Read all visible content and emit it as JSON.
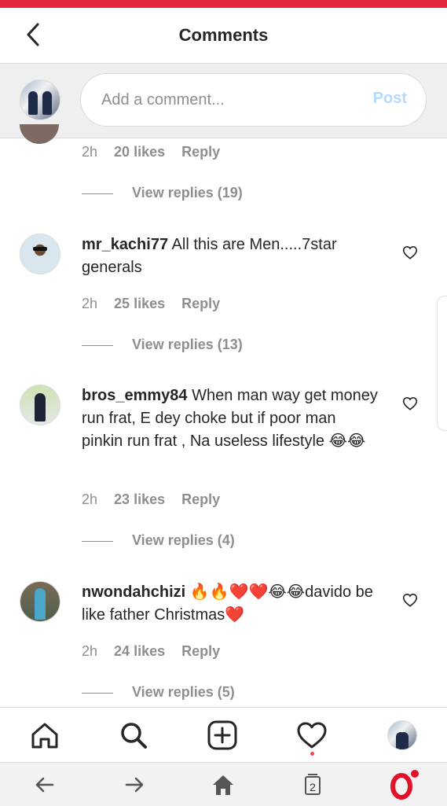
{
  "header": {
    "title": "Comments"
  },
  "composer": {
    "placeholder": "Add a comment...",
    "post_label": "Post"
  },
  "prev_comment": {
    "time": "2h",
    "likes": "20 likes",
    "reply": "Reply",
    "view_replies": "View replies (19)"
  },
  "comments": [
    {
      "username": "mr_kachi77",
      "text": "All this are Men.....7star generals",
      "time": "2h",
      "likes": "25 likes",
      "reply": "Reply",
      "view_replies": "View replies (13)"
    },
    {
      "username": "bros_emmy84",
      "text": "When man way get money run frat, E dey choke but if poor man pinkin run frat , Na useless lifestyle 😂😂",
      "time": "2h",
      "likes": "23 likes",
      "reply": "Reply",
      "view_replies": "View replies (4)"
    },
    {
      "username": "nwondahchizi",
      "text": "🔥🔥❤️❤️😂😂davido be like father Christmas❤️",
      "time": "2h",
      "likes": "24 likes",
      "reply": "Reply",
      "view_replies": "View replies (5)"
    }
  ],
  "browser": {
    "tab_count": "2"
  },
  "colors": {
    "accent_red": "#e5293d",
    "post_disabled": "#b3dbff",
    "meta_gray": "#8e8e8e",
    "notif_dot": "#ed4956"
  }
}
